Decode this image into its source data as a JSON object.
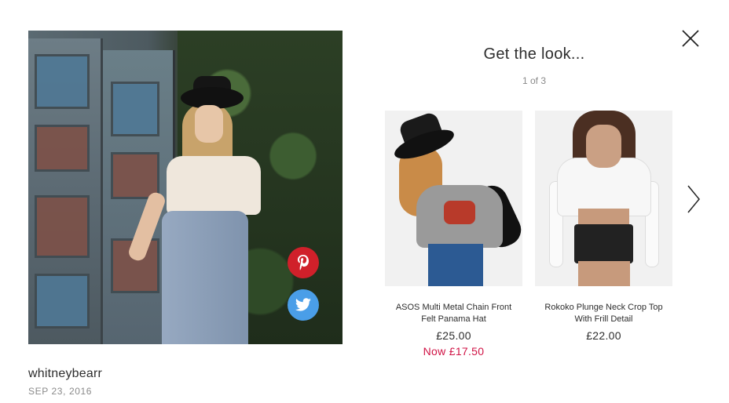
{
  "author": {
    "name": "whitneybearr",
    "date": "SEP 23, 2016"
  },
  "panel": {
    "title": "Get the look...",
    "pager": "1 of 3"
  },
  "share": {
    "pinterest_icon": "pinterest-icon",
    "twitter_icon": "twitter-icon"
  },
  "controls": {
    "close_icon": "close-icon",
    "next_icon": "chevron-right-icon"
  },
  "products": [
    {
      "name": "ASOS Multi Metal Chain Front Felt Panama Hat",
      "price": "£25.00",
      "sale_price": "Now £17.50"
    },
    {
      "name": "Rokoko Plunge Neck Crop Top With Frill Detail",
      "price": "£22.00"
    }
  ],
  "colors": {
    "pinterest": "#d0202a",
    "twitter": "#4a9ee8",
    "sale": "#d01345",
    "text": "#2d2d2d",
    "muted": "#8a8a8a"
  }
}
